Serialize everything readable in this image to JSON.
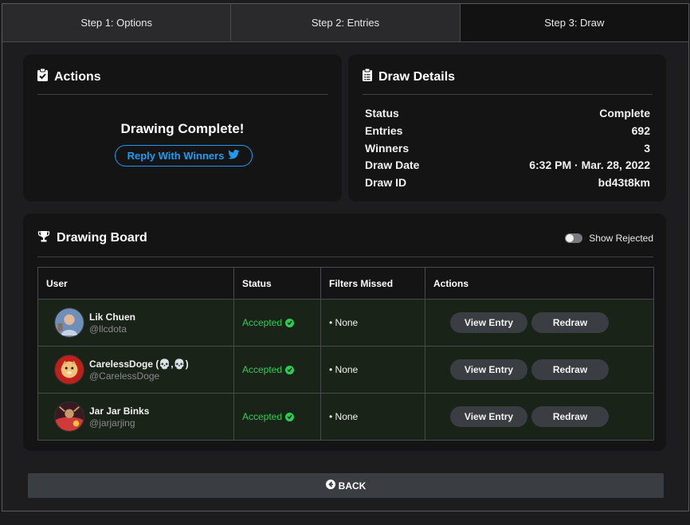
{
  "tabs": [
    {
      "label": "Step 1: Options",
      "active": false
    },
    {
      "label": "Step 2: Entries",
      "active": false
    },
    {
      "label": "Step 3: Draw",
      "active": true
    }
  ],
  "actions": {
    "title": "Actions",
    "status_message": "Drawing Complete!",
    "reply_button": "Reply With Winners"
  },
  "details": {
    "title": "Draw Details",
    "rows": [
      {
        "label": "Status",
        "value": "Complete"
      },
      {
        "label": "Entries",
        "value": "692"
      },
      {
        "label": "Winners",
        "value": "3"
      },
      {
        "label": "Draw Date",
        "value": "6:32 PM · Mar. 28, 2022"
      },
      {
        "label": "Draw ID",
        "value": "bd43t8km"
      }
    ]
  },
  "board": {
    "title": "Drawing Board",
    "toggle_label": "Show Rejected",
    "toggle_on": false,
    "columns": [
      "User",
      "Status",
      "Filters Missed",
      "Actions"
    ],
    "rows": [
      {
        "name": "Lik Chuen",
        "handle": "@llcdota",
        "status": "Accepted",
        "filters": "• None",
        "view_label": "View Entry",
        "redraw_label": "Redraw"
      },
      {
        "name": "CarelessDoge (💀,💀)",
        "handle": "@CarelessDoge",
        "status": "Accepted",
        "filters": "• None",
        "view_label": "View Entry",
        "redraw_label": "Redraw"
      },
      {
        "name": "Jar Jar Binks",
        "handle": "@jarjarjing",
        "status": "Accepted",
        "filters": "• None",
        "view_label": "View Entry",
        "redraw_label": "Redraw"
      }
    ]
  },
  "back_button": "BACK",
  "colors": {
    "accent_twitter": "#1d9bf0",
    "accepted_green": "#2ecc55",
    "card_bg": "#141415",
    "row_bg": "#1a2318"
  },
  "icons": {
    "actions": "clipboard-check-icon",
    "details": "clipboard-list-icon",
    "board": "trophy-icon",
    "reply": "twitter-icon",
    "back": "arrow-circle-left-icon",
    "status": "check-circle-icon"
  }
}
